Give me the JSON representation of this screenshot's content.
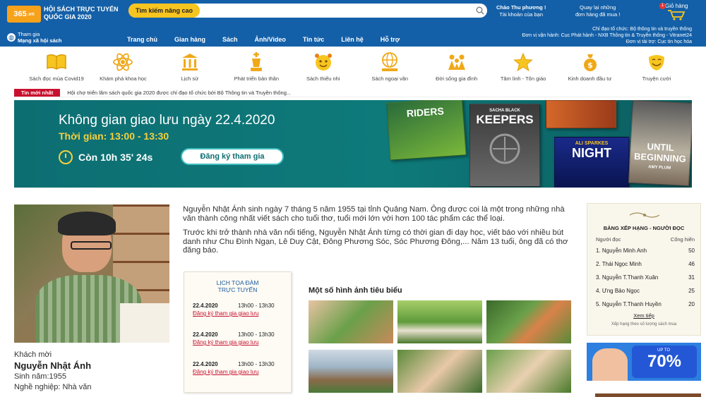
{
  "header": {
    "logo_text": "365",
    "logo_suffix": ".vn",
    "site_title_line1": "HỘI SÁCH TRỰC TUYẾN",
    "site_title_line2": "QUỐC GIA 2020",
    "search_button": "Tìm kiếm nâng cao",
    "search_placeholder": "",
    "greeting_line1": "Chào Thu phương !",
    "greeting_line2": "Tài khoản của bạn",
    "orders_line1": "Quay lại những",
    "orders_line2": "đơn hàng đã mua !",
    "cart_label": "Giỏ hàng",
    "cart_count": "1",
    "social_line1": "Tham gia",
    "social_line2": "Mạng xã hội sách",
    "nav": [
      "Trang chủ",
      "Gian hàng",
      "Sách",
      "Ảnh/Video",
      "Tin tức",
      "Liên hệ",
      "Hỗ trợ"
    ],
    "org_line1": "Chỉ đạo tổ chức: Bộ thông tin và truyền thông",
    "org_line2": "Đơn vị vận hành: Cục Phát hành - NXB Thông tin & Truyền thông - Vitranet24",
    "org_line3": "Đơn vị tài trợ: Cục tin học hóa"
  },
  "categories": [
    {
      "label": "Sách đọc mùa Covid19",
      "icon": "book-open-icon"
    },
    {
      "label": "Khám phá khoa học",
      "icon": "atom-icon"
    },
    {
      "label": "Lịch sử",
      "icon": "temple-icon"
    },
    {
      "label": "Phát triển bản thân",
      "icon": "chess-king-icon"
    },
    {
      "label": "Sách thiếu nhi",
      "icon": "child-face-icon"
    },
    {
      "label": "Sách ngoại văn",
      "icon": "globe-book-icon"
    },
    {
      "label": "Đời sống gia đình",
      "icon": "family-icon"
    },
    {
      "label": "Tâm linh - Tôn giáo",
      "icon": "star-icon"
    },
    {
      "label": "Kinh doanh đầu tư",
      "icon": "money-bag-icon"
    },
    {
      "label": "Truyện cười",
      "icon": "smile-mask-icon"
    }
  ],
  "ticker": {
    "tag": "Tin mới nhất",
    "text": "Hội chợ triển lãm sách quốc gia 2020 được chỉ đạo tổ chức bởi Bộ Thông tin và Truyền thông..."
  },
  "banner": {
    "title": "Không gian giao lưu ngày 22.4.2020",
    "time": "Thời gian: 13:00 - 13:30",
    "countdown": "Còn 10h 35' 24s",
    "register_button": "Đăng ký tham gia",
    "book_titles": [
      "RIDERS",
      "KEEPERS",
      "NIGHT",
      "UNTIL BEGINNING"
    ],
    "book_authors": [
      "SACHA BLACK",
      "ALI SPARKES",
      "AMY PLUM"
    ]
  },
  "guest": {
    "label": "Khách mời",
    "name": "Nguyễn Nhật Ánh",
    "birth": "Sinh năm:1955",
    "job": "Nghề nghiệp: Nhà văn"
  },
  "bio": {
    "p1": "Nguyễn Nhật Ánh sinh ngày 7 tháng 5 năm 1955 tại tỉnh Quảng Nam. Ông được coi là một trong những nhà văn thành công nhất viết sách cho tuổi thơ, tuổi mới lớn với hơn 100 tác phẩm các thể loại.",
    "p2": "Trước khi trở thành nhà văn nổi tiếng, Nguyễn Nhật Ánh từng có thời gian đi dạy học, viết báo với nhiều bút danh như Chu Đình Ngạn, Lê Duy Cật, Đông Phương Sóc, Sóc Phương Đông,... Năm 13 tuổi, ông đã có thơ đăng báo."
  },
  "schedule": {
    "title_line1": "LỊCH TỌA ĐÀM",
    "title_line2": "TRỰC TUYẾN",
    "rows": [
      {
        "date": "22.4.2020",
        "time": "13h00 - 13h30",
        "link": "Đăng ký tham gia giao lưu"
      },
      {
        "date": "22.4.2020",
        "time": "13h00 - 13h30",
        "link": "Đăng ký tham gia giao lưu"
      },
      {
        "date": "22.4.2020",
        "time": "13h00 - 13h30",
        "link": "Đăng ký tham gia giao lưu"
      }
    ]
  },
  "gallery": {
    "title": "Một số hình ảnh tiêu biểu"
  },
  "ranking": {
    "title": "BẢNG XẾP HẠNG - NGƯỜI ĐỌC",
    "col_reader": "Người đọc",
    "col_books": "Cống hiến",
    "rows": [
      {
        "name": "1. Nguyễn Minh Anh",
        "score": "50"
      },
      {
        "name": "2. Thái Ngọc Minh",
        "score": "46"
      },
      {
        "name": "3. Nguyễn T.Thanh Xuân",
        "score": "31"
      },
      {
        "name": "4. Ưng Bảo Ngọc",
        "score": "25"
      },
      {
        "name": "5. Nguyễn T.Thanh Huyền",
        "score": "20"
      }
    ],
    "more_link": "Xem tiếp",
    "note": "Xếp hạng theo số lượng sách mua"
  },
  "promo": {
    "upto": "UP TO",
    "percent": "70%"
  },
  "colors": {
    "header_blue": "#1460a8",
    "accent_orange": "#f7a21b",
    "accent_yellow": "#f7c520",
    "ticker_red": "#c8102e",
    "banner_teal": "#0e7a7a"
  }
}
